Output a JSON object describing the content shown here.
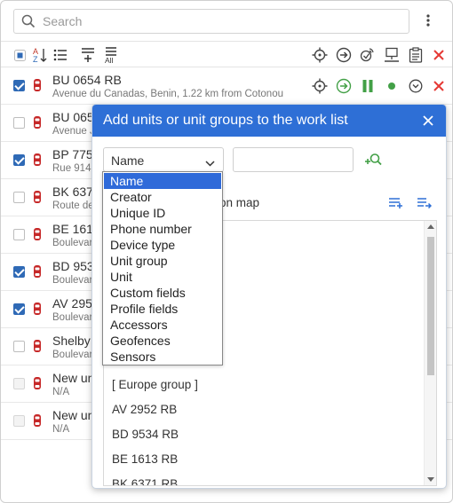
{
  "search": {
    "placeholder": "Search"
  },
  "menu": {
    "icon": "more-vertical-icon"
  },
  "toolbar": {
    "left_icons": [
      "select-all-icon",
      "sort-az-icon",
      "list-icon",
      "add-to-list-icon",
      "add-all-icon"
    ],
    "right_icons": [
      "locate-icon",
      "command-icon",
      "ping-icon",
      "monitor-icon",
      "clipboard-icon",
      "remove-icon"
    ],
    "sort_top": "A",
    "sort_bottom": "Z",
    "all_label": "All"
  },
  "units": [
    {
      "name": "BU 0654 RB",
      "address": "Avenue du Canadas, Benin, 1.22 km from Cotonou",
      "checked": true,
      "disabled": false
    },
    {
      "name": "BU 065",
      "address": "Avenue J",
      "checked": false,
      "disabled": false
    },
    {
      "name": "BP 775",
      "address": "Rue 914,",
      "checked": true,
      "disabled": false
    },
    {
      "name": "BK 637",
      "address": "Route de",
      "checked": false,
      "disabled": false
    },
    {
      "name": "BE 1613",
      "address": "Boulevar",
      "checked": false,
      "disabled": false
    },
    {
      "name": "BD 953",
      "address": "Boulevar",
      "checked": true,
      "disabled": false
    },
    {
      "name": "AV 2952",
      "address": "Boulevar",
      "checked": true,
      "disabled": false
    },
    {
      "name": "Shelby",
      "address": "Boulevar",
      "checked": false,
      "disabled": false
    },
    {
      "name": "New un",
      "address": "N/A",
      "checked": false,
      "disabled": true
    },
    {
      "name": "New un",
      "address": "N/A",
      "checked": false,
      "disabled": true
    }
  ],
  "dialog": {
    "title": "Add units or unit groups to the work list",
    "close_icon": "close-icon",
    "filter_select_value": "Name",
    "filter_input_value": "",
    "add_search_icon": "add-search-icon",
    "map_checkbox_label": "on map",
    "list_items": [
      "[ Europe group ]",
      "AV 2952 RB",
      "BD 9534 RB",
      "BE 1613 RB",
      "BK 6371 RB"
    ]
  },
  "dropdown": {
    "selected": "Name",
    "options": [
      "Name",
      "Creator",
      "Unique ID",
      "Phone number",
      "Device type",
      "Unit group",
      "Unit",
      "Custom fields",
      "Profile fields",
      "Accessors",
      "Geofences",
      "Sensors"
    ]
  },
  "colors": {
    "accent": "#2e6fd6",
    "remove": "#e53935",
    "go": "#43a047",
    "checkbox": "#2f6ab6"
  }
}
